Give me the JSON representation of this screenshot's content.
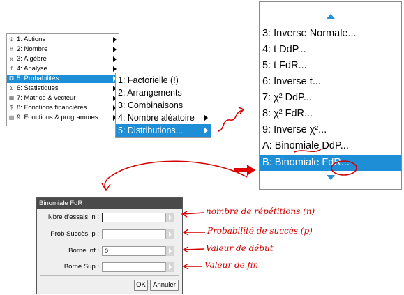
{
  "main_menu": {
    "items": [
      {
        "icon": "actions-icon",
        "glyph": "⚙",
        "label": "1: Actions"
      },
      {
        "icon": "number-icon",
        "glyph": "#",
        "label": "2: Nombre"
      },
      {
        "icon": "algebra-icon",
        "glyph": "x",
        "label": "3: Algèbre"
      },
      {
        "icon": "analysis-icon",
        "glyph": "f",
        "label": "4: Analyse"
      },
      {
        "icon": "probability-icon",
        "glyph": "⚅",
        "label": "5: Probabilités"
      },
      {
        "icon": "statistics-icon",
        "glyph": "Σ",
        "label": "6: Statistiques"
      },
      {
        "icon": "matrix-icon",
        "glyph": "▦",
        "label": "7: Matrice & vecteur"
      },
      {
        "icon": "finance-icon",
        "glyph": "$",
        "label": "8: Fonctions financières"
      },
      {
        "icon": "program-icon",
        "glyph": "▤",
        "label": "9: Fonctions & programmes"
      }
    ],
    "selected_index": 4
  },
  "prob_menu": {
    "items": [
      "1: Factorielle (!)",
      "2: Arrangements",
      "3: Combinaisons",
      "4: Nombre aléatoire",
      "5: Distributions..."
    ],
    "selected_index": 4
  },
  "dist_menu": {
    "items": [
      "3: Inverse Normale...",
      "4: t DdP...",
      "5: t FdR...",
      "6: Inverse t...",
      "7: χ² DdP...",
      "8: χ² FdR...",
      "9: Inverse χ²...",
      "A: Binomiale DdP...",
      "B: Binomiale FdR..."
    ],
    "selected_index": 8
  },
  "dialog": {
    "title": "Binomiale FdR",
    "fields": [
      {
        "label": "Nbre d'essais, n :",
        "value": ""
      },
      {
        "label": "Prob Succès, p :",
        "value": ""
      },
      {
        "label": "Borne Inf :",
        "value": "0"
      },
      {
        "label": "Borne Sup :",
        "value": ""
      }
    ],
    "ok_label": "OK",
    "cancel_label": "Annuler"
  },
  "annotations": [
    "nombre de répétitions (n)",
    "Probabilité de succès (p)",
    "Valeur de début",
    "Valeur de fin"
  ],
  "colors": {
    "selection": "#1e8fd6",
    "annotation": "#d40000",
    "dialog_title": "#4a4a4a"
  }
}
